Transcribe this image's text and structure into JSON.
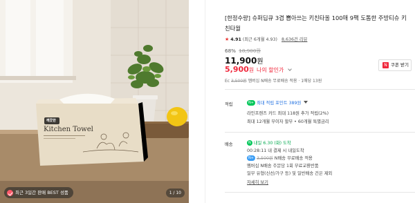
{
  "image": {
    "badge_text": "최근 3일간 판매 BEST 성품",
    "page_indicator": "1 / 10",
    "product_box_label": "Kitchen Towel",
    "product_box_brand": "깨끗한"
  },
  "product": {
    "title": "[한정수량] 슈퍼딥큐 3겹 뽑아쓰는 키친타올 100매 9팩 도톰한 주방티슈 키친타월",
    "rating_score": "4.91",
    "rating_note": "(최근 6개월 4.93",
    "review_count": "8,636건 리뷰",
    "discount_pct": "68%",
    "original_price": "18,900원",
    "price": "11,900",
    "price_unit": "원",
    "my_price": "5,900",
    "my_price_unit": "원",
    "my_price_label": "나의 할인가",
    "coupon_label": "쿠폰 받기",
    "ship_summary_prefix": "Ec",
    "ship_summary_strike": "3,500원",
    "ship_summary_rest": "멤버십 N배송 무료배송 적용 · 1매당 13원"
  },
  "points": {
    "label": "적립",
    "line1_badge": "N+",
    "line1_text": "최대 적립 포인트",
    "line1_value": "389원",
    "line2": "라인프렌즈 카드 최대 118원 추가 적립(2%)",
    "line3": "최대 12개월 무이자 할부 • 60개월 특별금리"
  },
  "shipping": {
    "label": "배송",
    "line1_badge": "N",
    "line1_text": "내일 6.30 (화) 도착",
    "line2": "00:28:11 내 결제 시 내일도착",
    "line3_badge": "N+",
    "line3_strike": "3,500원",
    "line3_text": "N배송 무료배송 적용",
    "line4": "멤버십 N배송 주문당 1회 무료교환반품",
    "line5": "일부 유형(신선/가구 등) 및 일반배송 건은 제외",
    "more_label": "자세히 보기"
  },
  "colors": {
    "accent_red": "#f0283c",
    "naver_green": "#03c75a",
    "link_blue": "#1f6fe0"
  }
}
